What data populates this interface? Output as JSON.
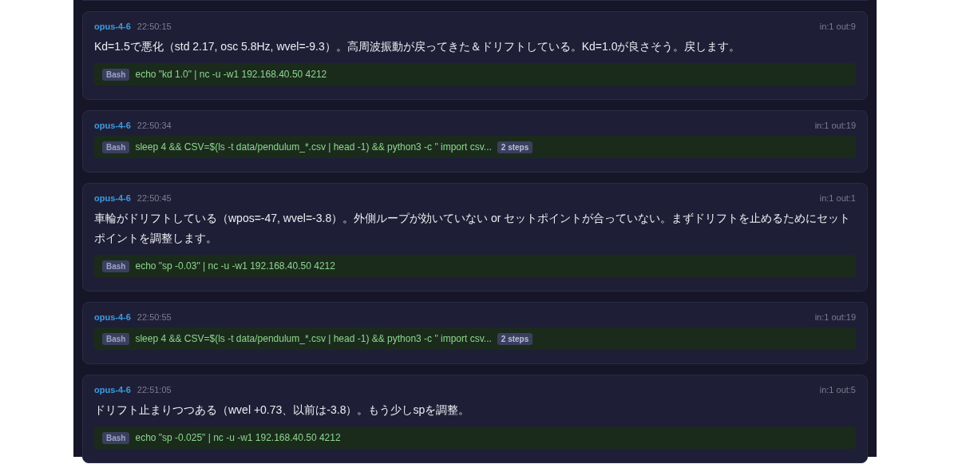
{
  "messages": [
    {
      "model": "opus-4-6",
      "time": "22:50:15",
      "tokens": "in:1 out:9",
      "text": "Kd=1.5で悪化（std 2.17, osc 5.8Hz, wvel=-9.3）。高周波振動が戻ってきた＆ドリフトしている。Kd=1.0が良さそう。戻します。",
      "tool": {
        "name": "Bash",
        "command": "echo \"kd 1.0\" | nc -u -w1 192.168.40.50 4212"
      }
    },
    {
      "model": "opus-4-6",
      "time": "22:50:34",
      "tokens": "in:1 out:19",
      "tool": {
        "name": "Bash",
        "command": "sleep 4 && CSV=$(ls -t data/pendulum_*.csv | head -1) && python3 -c \" import csv...",
        "steps": "2 steps"
      }
    },
    {
      "model": "opus-4-6",
      "time": "22:50:45",
      "tokens": "in:1 out:1",
      "text": "車輪がドリフトしている（wpos=-47, wvel=-3.8）。外側ループが効いていない or セットポイントが合っていない。まずドリフトを止めるためにセットポイントを調整します。",
      "tool": {
        "name": "Bash",
        "command": "echo \"sp -0.03\" | nc -u -w1 192.168.40.50 4212"
      }
    },
    {
      "model": "opus-4-6",
      "time": "22:50:55",
      "tokens": "in:1 out:19",
      "tool": {
        "name": "Bash",
        "command": "sleep 4 && CSV=$(ls -t data/pendulum_*.csv | head -1) && python3 -c \" import csv...",
        "steps": "2 steps"
      }
    },
    {
      "model": "opus-4-6",
      "time": "22:51:05",
      "tokens": "in:1 out:5",
      "text": "ドリフト止まりつつある（wvel +0.73、以前は-3.8）。もう少しspを調整。",
      "tool": {
        "name": "Bash",
        "command": "echo \"sp -0.025\" | nc -u -w1 192.168.40.50 4212"
      }
    }
  ]
}
